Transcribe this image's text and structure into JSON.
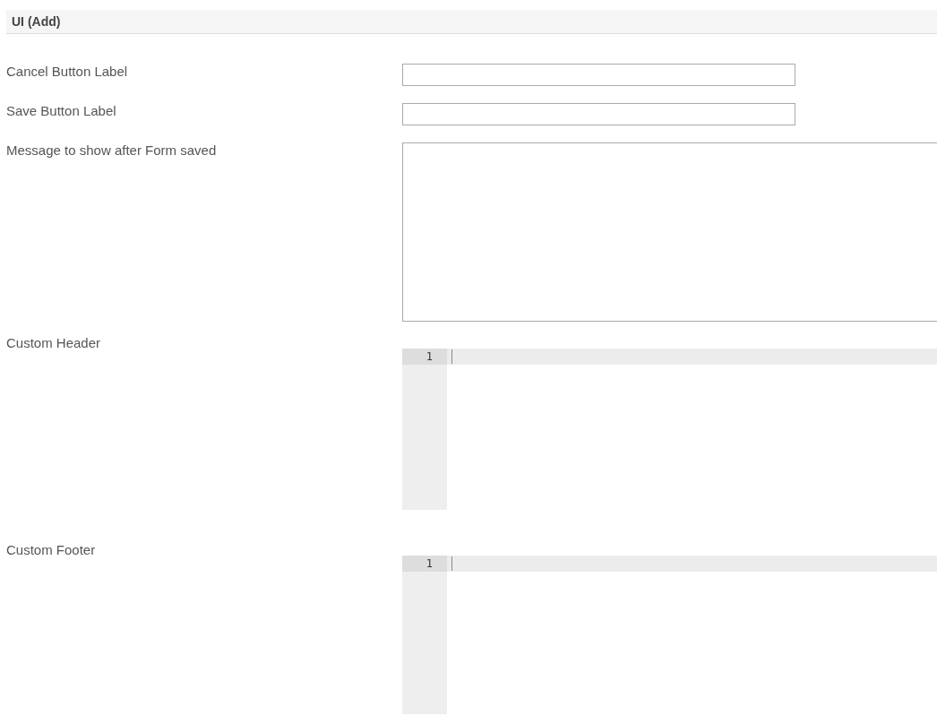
{
  "section": {
    "title": "UI (Add)"
  },
  "fields": [
    {
      "kind": "text",
      "label": "Cancel Button Label"
    },
    {
      "kind": "text",
      "label": "Save Button Label"
    },
    {
      "kind": "textarea",
      "label": "Message to show after Form saved"
    },
    {
      "kind": "code",
      "label": "Custom Header",
      "line_numbers": [
        "1"
      ]
    },
    {
      "kind": "code",
      "label": "Custom Footer",
      "line_numbers": [
        "1"
      ]
    }
  ]
}
